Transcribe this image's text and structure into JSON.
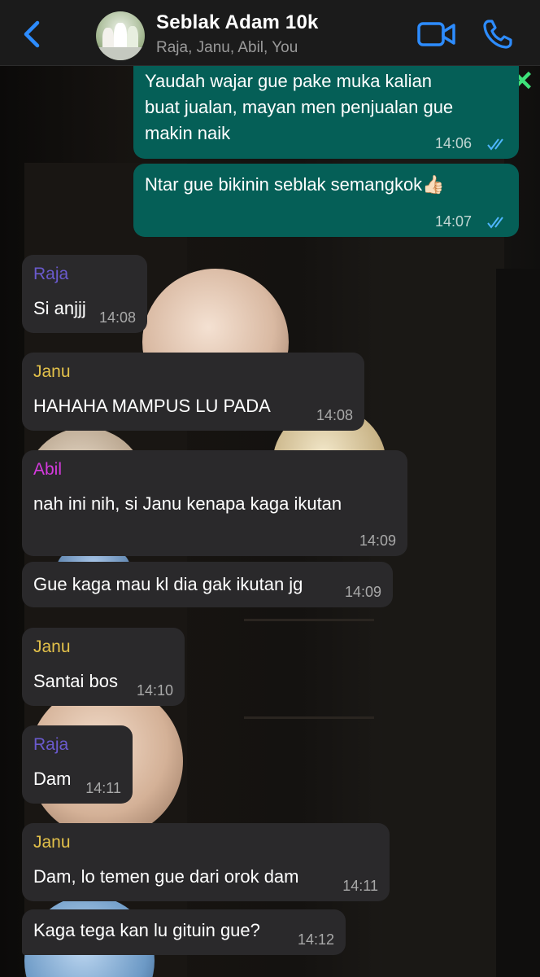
{
  "header": {
    "title": "Seblak Adam 10k",
    "participants": "Raja, Janu, Abil, You",
    "accent_color": "#2d8cff",
    "icons": [
      "chevron-left-icon",
      "video-camera-icon",
      "phone-icon"
    ]
  },
  "colors": {
    "incoming_bubble": "#2a292b",
    "outgoing_bubble": "#055f57",
    "sender_raja": "#6a5acd",
    "sender_janu": "#e3c14a",
    "sender_abil": "#d63adf",
    "read_ticks": "#4fb6ff"
  },
  "messages": [
    {
      "direction": "out",
      "text": "Yaudah wajar gue pake muka kalian\nbuat jualan, mayan men penjualan gue\nmakin naik",
      "time": "14:06",
      "status": "read"
    },
    {
      "direction": "out",
      "text": "Ntar gue bikinin seblak semangkok👍🏻",
      "time": "14:07",
      "status": "read"
    },
    {
      "direction": "in",
      "sender": "Raja",
      "text": "Si anjjj",
      "time": "14:08"
    },
    {
      "direction": "in",
      "sender": "Janu",
      "text": "HAHAHA MAMPUS LU PADA",
      "time": "14:08"
    },
    {
      "direction": "in",
      "sender": "Abil",
      "text": "nah ini nih, si Janu kenapa kaga ikutan",
      "time": "14:09"
    },
    {
      "direction": "in",
      "text": "Gue kaga mau kl dia gak ikutan jg",
      "time": "14:09"
    },
    {
      "direction": "in",
      "sender": "Janu",
      "text": "Santai bos",
      "time": "14:10"
    },
    {
      "direction": "in",
      "sender": "Raja",
      "text": "Dam",
      "time": "14:11"
    },
    {
      "direction": "in",
      "sender": "Janu",
      "text": "Dam, lo temen gue dari orok dam",
      "time": "14:11"
    },
    {
      "direction": "in",
      "text": "Kaga tega kan lu gituin gue?",
      "time": "14:12"
    }
  ]
}
